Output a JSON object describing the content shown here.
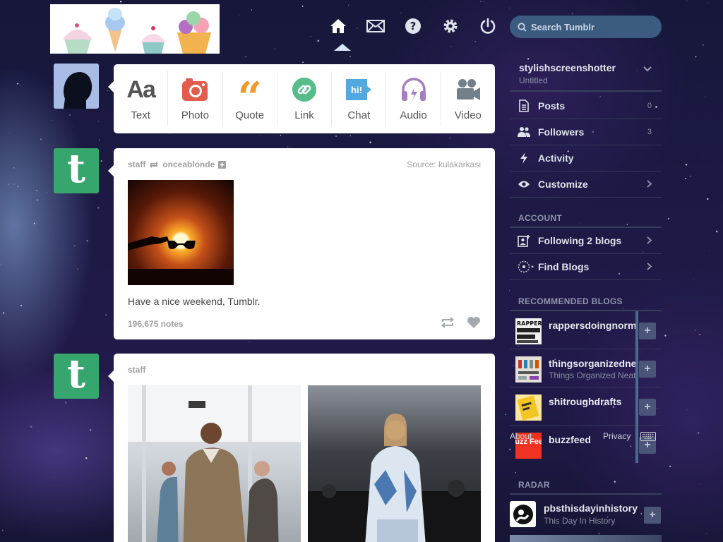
{
  "colors": {
    "accent": "#3b5b7f",
    "tumblr_green": "#36a56e",
    "text_icon": "#555555",
    "photo_icon": "#e25d4b",
    "quote_icon": "#f2992e",
    "link_icon": "#56bc8a",
    "chat_icon": "#52a9e0",
    "audio_icon": "#a77dc2",
    "video_icon": "#748089"
  },
  "search": {
    "placeholder": "Search Tumblr"
  },
  "composer": {
    "items": [
      {
        "label": "Text",
        "icon": "text-icon"
      },
      {
        "label": "Photo",
        "icon": "camera-icon"
      },
      {
        "label": "Quote",
        "icon": "quote-icon"
      },
      {
        "label": "Link",
        "icon": "link-icon"
      },
      {
        "label": "Chat",
        "icon": "chat-icon",
        "glyph": "hi!"
      },
      {
        "label": "Audio",
        "icon": "headphones-icon"
      },
      {
        "label": "Video",
        "icon": "video-camera-icon"
      }
    ]
  },
  "posts": [
    {
      "author": "staff",
      "reblogged_from": "onceablonde",
      "source_label": "Source:",
      "source": "kulakarkasi",
      "text": "Have a nice weekend, Tumblr.",
      "notes": "196,675 notes"
    },
    {
      "author": "staff"
    }
  ],
  "sidebar": {
    "blog_name": "stylishscreenshotter",
    "blog_subtitle": "Untitled",
    "rows": [
      {
        "label": "Posts",
        "count": "0"
      },
      {
        "label": "Followers",
        "count": "3"
      },
      {
        "label": "Activity"
      },
      {
        "label": "Customize"
      }
    ],
    "account_title": "ACCOUNT",
    "account_rows": [
      {
        "label": "Following 2 blogs"
      },
      {
        "label": "Find Blogs"
      }
    ],
    "recommended_title": "RECOMMENDED BLOGS",
    "recommended": [
      {
        "name": "rappersdoingnormalshit",
        "subtitle": "",
        "thumb_text": "RAPPERS DOING NORMAL SHIT"
      },
      {
        "name": "thingsorganizedneatly",
        "subtitle": "Things Organized Neatly"
      },
      {
        "name": "shitroughdrafts",
        "subtitle": ""
      },
      {
        "name": "buzzfeed",
        "subtitle": "",
        "thumb_text": "Buzz Feed"
      }
    ],
    "footer": {
      "about": "About",
      "privacy": "Privacy"
    },
    "radar_title": "RADAR",
    "radar": {
      "name": "pbsthisdayinhistory",
      "subtitle": "This Day In History"
    }
  }
}
